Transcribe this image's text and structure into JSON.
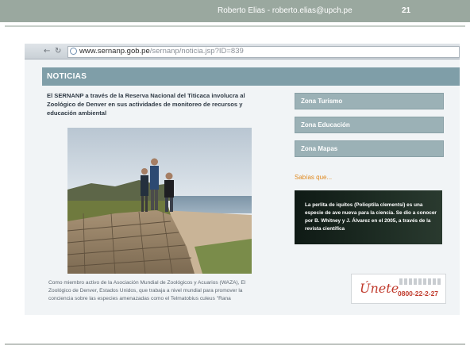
{
  "slide": {
    "credit": "Roberto Elias - roberto.elias@upch.pe",
    "slide_number": "21"
  },
  "browser": {
    "back_icon": "back-arrow-icon",
    "reload_icon": "reload-icon",
    "url_domain": "www.sernanp.gob.pe",
    "url_path": "/sernanp/noticia.jsp?ID=839"
  },
  "page": {
    "section_title": "NOTICIAS",
    "article_title": "El SERNANP a través de la Reserva Nacional del Titicaca involucra al Zoológico de Denver en sus actividades de monitoreo de recursos y educación ambiental",
    "article_body": "Como miembro activo de la Asociación Mundial de Zoológicos y Acuarios (WAZA), El Zoológico de Denver, Estados Unidos, que trabaja a nivel mundial para promover la conciencia sobre las especies amenazadas como el Telmatobius culeus \"Rana",
    "sidebar_buttons": [
      "Zona Turismo",
      "Zona Educación",
      "Zona Mapas"
    ],
    "sabias_label": "Sabías que...",
    "fact_text": "La perlita de iquitos (Polioptila clementsi) es una especie de ave nueva para la ciencia. Se dio a conocer por B. Whitney y J. Álvarez en el 2005, a través de la revista científica",
    "ad_text": "Únete",
    "ad_phone": "0800-22-2-27"
  },
  "colors": {
    "header_bar": "#9aa89f",
    "news_bar": "#7f9ea8",
    "sidebar_button": "#9bb1b6",
    "sabias": "#e08a20",
    "ad_red": "#c0392b"
  }
}
